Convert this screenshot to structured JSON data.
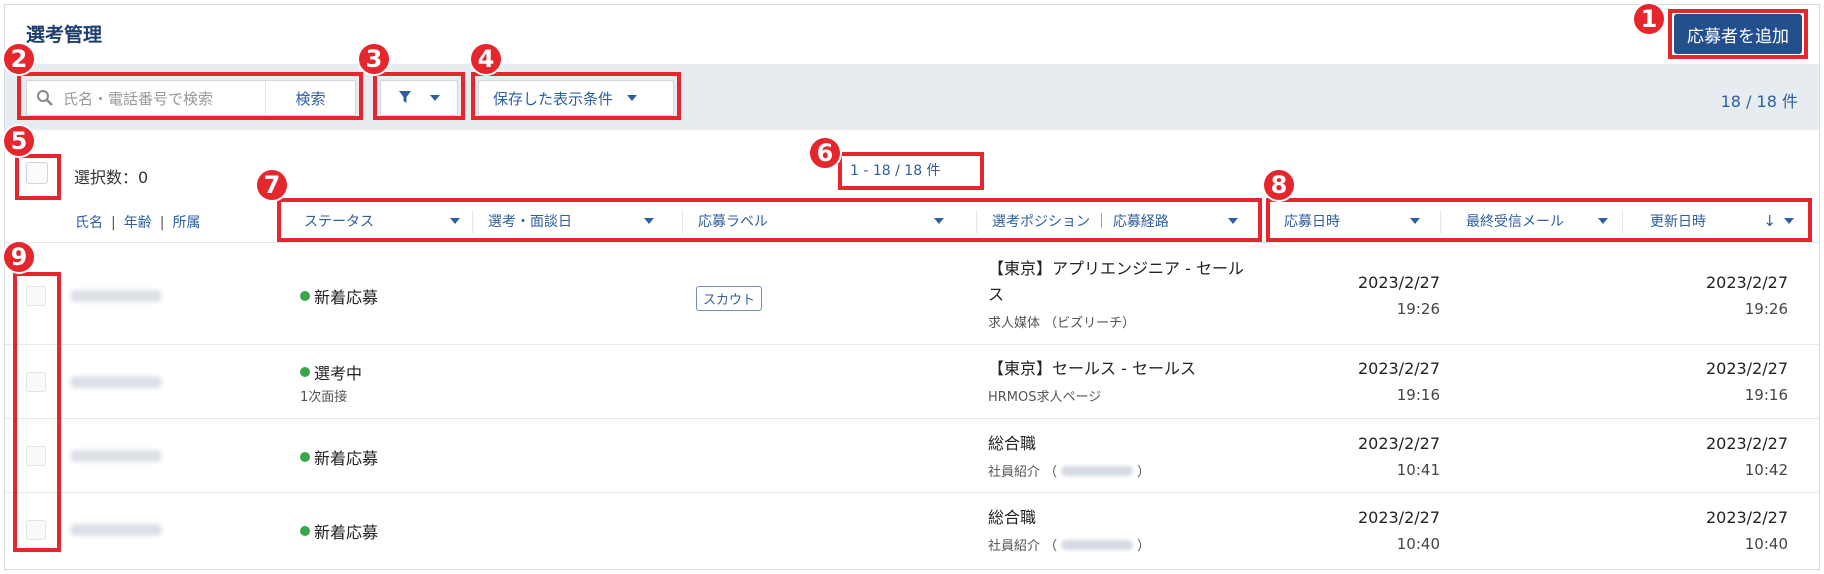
{
  "header": {
    "title": "選考管理",
    "add_button": "応募者を追加"
  },
  "toolbar": {
    "search_placeholder": "氏名・電話番号で検索",
    "search_button": "検索",
    "saved_conditions": "保存した表示条件",
    "total_count": "18 / 18 件"
  },
  "selection": {
    "label": "選択数：0"
  },
  "pagination": "1 - 18 / 18 件",
  "sub_labels": [
    "氏名",
    "年齢",
    "所属"
  ],
  "columns_left": [
    "ステータス",
    "選考・面談日",
    "応募ラベル",
    "選考ポジション ｜ 応募経路"
  ],
  "columns_right": [
    "応募日時",
    "最終受信メール",
    "更新日時"
  ],
  "rows": [
    {
      "status": "新着応募",
      "status_sub": "",
      "label": "スカウト",
      "position": "【東京】アプリエンジニア - セールス",
      "source": "求人媒体 （ビズリーチ）",
      "applied_date": "2023/2/27",
      "applied_time": "19:26",
      "updated_date": "2023/2/27",
      "updated_time": "19:26"
    },
    {
      "status": "選考中",
      "status_sub": "1次面接",
      "label": "",
      "position": "【東京】セールス - セールス",
      "source": "HRMOS求人ページ",
      "applied_date": "2023/2/27",
      "applied_time": "19:16",
      "updated_date": "2023/2/27",
      "updated_time": "19:16"
    },
    {
      "status": "新着応募",
      "status_sub": "",
      "label": "",
      "position": "総合職",
      "source_prefix": "社員紹介 （",
      "source_suffix": "）",
      "applied_date": "2023/2/27",
      "applied_time": "10:41",
      "updated_date": "2023/2/27",
      "updated_time": "10:42"
    },
    {
      "status": "新着応募",
      "status_sub": "",
      "label": "",
      "position": "総合職",
      "source_prefix": "社員紹介 （",
      "source_suffix": "）",
      "applied_date": "2023/2/27",
      "applied_time": "10:40",
      "updated_date": "2023/2/27",
      "updated_time": "10:40"
    }
  ],
  "annotations": [
    "1",
    "2",
    "3",
    "4",
    "5",
    "6",
    "7",
    "8",
    "9"
  ],
  "colors": {
    "accent": "#23508c",
    "link": "#2d5fa0",
    "annotation": "#e5262d",
    "status_dot": "#3aa54a"
  }
}
